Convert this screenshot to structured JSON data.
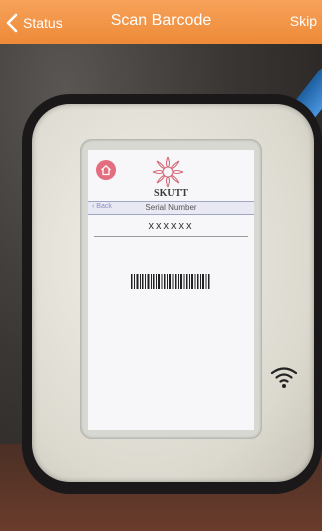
{
  "navbar": {
    "back_label": "Status",
    "title": "Scan Barcode",
    "skip_label": "Skip",
    "color": "#f29744"
  },
  "device_screen": {
    "brand": "SKUTT",
    "back_label": "Back",
    "title": "Serial Number",
    "serial_value": "xxxxxx",
    "icons": [
      "home-icon",
      "logo-icon",
      "barcode-icon"
    ]
  },
  "device_body": {
    "icons": [
      "wifi-icon"
    ]
  }
}
